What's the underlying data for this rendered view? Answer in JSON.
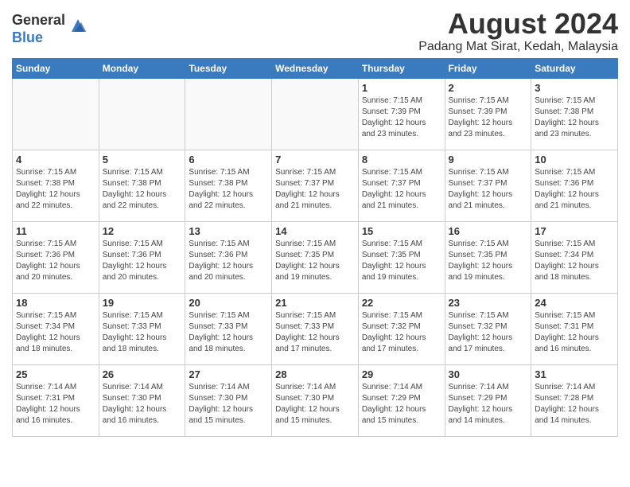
{
  "logo": {
    "general": "General",
    "blue": "Blue"
  },
  "title": "August 2024",
  "location": "Padang Mat Sirat, Kedah, Malaysia",
  "days": [
    "Sunday",
    "Monday",
    "Tuesday",
    "Wednesday",
    "Thursday",
    "Friday",
    "Saturday"
  ],
  "weeks": [
    [
      {
        "day": "",
        "text": ""
      },
      {
        "day": "",
        "text": ""
      },
      {
        "day": "",
        "text": ""
      },
      {
        "day": "",
        "text": ""
      },
      {
        "day": "1",
        "text": "Sunrise: 7:15 AM\nSunset: 7:39 PM\nDaylight: 12 hours\nand 23 minutes."
      },
      {
        "day": "2",
        "text": "Sunrise: 7:15 AM\nSunset: 7:39 PM\nDaylight: 12 hours\nand 23 minutes."
      },
      {
        "day": "3",
        "text": "Sunrise: 7:15 AM\nSunset: 7:38 PM\nDaylight: 12 hours\nand 23 minutes."
      }
    ],
    [
      {
        "day": "4",
        "text": "Sunrise: 7:15 AM\nSunset: 7:38 PM\nDaylight: 12 hours\nand 22 minutes."
      },
      {
        "day": "5",
        "text": "Sunrise: 7:15 AM\nSunset: 7:38 PM\nDaylight: 12 hours\nand 22 minutes."
      },
      {
        "day": "6",
        "text": "Sunrise: 7:15 AM\nSunset: 7:38 PM\nDaylight: 12 hours\nand 22 minutes."
      },
      {
        "day": "7",
        "text": "Sunrise: 7:15 AM\nSunset: 7:37 PM\nDaylight: 12 hours\nand 21 minutes."
      },
      {
        "day": "8",
        "text": "Sunrise: 7:15 AM\nSunset: 7:37 PM\nDaylight: 12 hours\nand 21 minutes."
      },
      {
        "day": "9",
        "text": "Sunrise: 7:15 AM\nSunset: 7:37 PM\nDaylight: 12 hours\nand 21 minutes."
      },
      {
        "day": "10",
        "text": "Sunrise: 7:15 AM\nSunset: 7:36 PM\nDaylight: 12 hours\nand 21 minutes."
      }
    ],
    [
      {
        "day": "11",
        "text": "Sunrise: 7:15 AM\nSunset: 7:36 PM\nDaylight: 12 hours\nand 20 minutes."
      },
      {
        "day": "12",
        "text": "Sunrise: 7:15 AM\nSunset: 7:36 PM\nDaylight: 12 hours\nand 20 minutes."
      },
      {
        "day": "13",
        "text": "Sunrise: 7:15 AM\nSunset: 7:36 PM\nDaylight: 12 hours\nand 20 minutes."
      },
      {
        "day": "14",
        "text": "Sunrise: 7:15 AM\nSunset: 7:35 PM\nDaylight: 12 hours\nand 19 minutes."
      },
      {
        "day": "15",
        "text": "Sunrise: 7:15 AM\nSunset: 7:35 PM\nDaylight: 12 hours\nand 19 minutes."
      },
      {
        "day": "16",
        "text": "Sunrise: 7:15 AM\nSunset: 7:35 PM\nDaylight: 12 hours\nand 19 minutes."
      },
      {
        "day": "17",
        "text": "Sunrise: 7:15 AM\nSunset: 7:34 PM\nDaylight: 12 hours\nand 18 minutes."
      }
    ],
    [
      {
        "day": "18",
        "text": "Sunrise: 7:15 AM\nSunset: 7:34 PM\nDaylight: 12 hours\nand 18 minutes."
      },
      {
        "day": "19",
        "text": "Sunrise: 7:15 AM\nSunset: 7:33 PM\nDaylight: 12 hours\nand 18 minutes."
      },
      {
        "day": "20",
        "text": "Sunrise: 7:15 AM\nSunset: 7:33 PM\nDaylight: 12 hours\nand 18 minutes."
      },
      {
        "day": "21",
        "text": "Sunrise: 7:15 AM\nSunset: 7:33 PM\nDaylight: 12 hours\nand 17 minutes."
      },
      {
        "day": "22",
        "text": "Sunrise: 7:15 AM\nSunset: 7:32 PM\nDaylight: 12 hours\nand 17 minutes."
      },
      {
        "day": "23",
        "text": "Sunrise: 7:15 AM\nSunset: 7:32 PM\nDaylight: 12 hours\nand 17 minutes."
      },
      {
        "day": "24",
        "text": "Sunrise: 7:15 AM\nSunset: 7:31 PM\nDaylight: 12 hours\nand 16 minutes."
      }
    ],
    [
      {
        "day": "25",
        "text": "Sunrise: 7:14 AM\nSunset: 7:31 PM\nDaylight: 12 hours\nand 16 minutes."
      },
      {
        "day": "26",
        "text": "Sunrise: 7:14 AM\nSunset: 7:30 PM\nDaylight: 12 hours\nand 16 minutes."
      },
      {
        "day": "27",
        "text": "Sunrise: 7:14 AM\nSunset: 7:30 PM\nDaylight: 12 hours\nand 15 minutes."
      },
      {
        "day": "28",
        "text": "Sunrise: 7:14 AM\nSunset: 7:30 PM\nDaylight: 12 hours\nand 15 minutes."
      },
      {
        "day": "29",
        "text": "Sunrise: 7:14 AM\nSunset: 7:29 PM\nDaylight: 12 hours\nand 15 minutes."
      },
      {
        "day": "30",
        "text": "Sunrise: 7:14 AM\nSunset: 7:29 PM\nDaylight: 12 hours\nand 14 minutes."
      },
      {
        "day": "31",
        "text": "Sunrise: 7:14 AM\nSunset: 7:28 PM\nDaylight: 12 hours\nand 14 minutes."
      }
    ]
  ]
}
